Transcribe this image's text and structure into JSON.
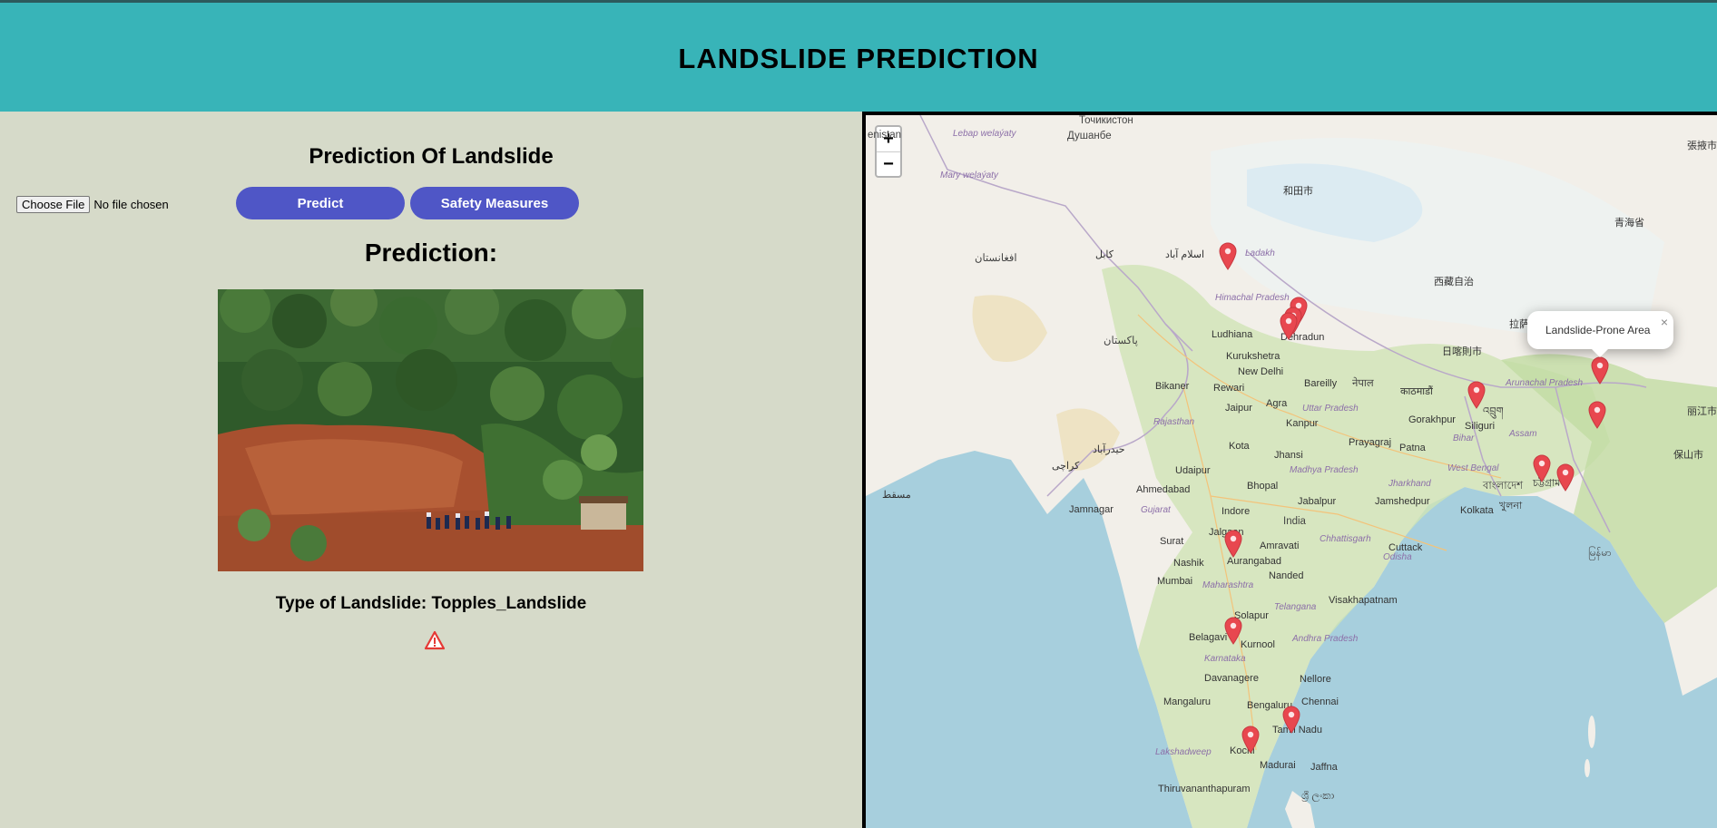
{
  "header": {
    "title": "LANDSLIDE PREDICTION"
  },
  "left": {
    "section_title": "Prediction Of Landslide",
    "file_button": "Choose File",
    "file_status": "No file chosen",
    "predict_button": "Predict",
    "safety_button": "Safety Measures",
    "prediction_label": "Prediction:",
    "type_text": "Type of Landslide: Topples_Landslide"
  },
  "map": {
    "zoom_in": "+",
    "zoom_out": "−",
    "popup_text": "Landslide-Prone Area",
    "popup_close": "×",
    "labels": {
      "dushanbe": "Душанбе",
      "tajik": "Точикистон",
      "turkmenistan": "enistan",
      "lebap": "Lebap welaýaty",
      "mary": "Mary welaýaty",
      "afghanistan": "افغانستان",
      "kabul": "کابل",
      "islamabad": "اسلام آباد",
      "pakistan": "پاکستان",
      "ladakh": "Ladakh",
      "himachal": "Himachal Pradesh",
      "dehradun": "Dehradun",
      "ludhiana": "Ludhiana",
      "kurukshetra": "Kurukshetra",
      "newdelhi": "New Delhi",
      "rewari": "Rewari",
      "bikaner": "Bikaner",
      "jaipur": "Jaipur",
      "agra": "Agra",
      "kanpur": "Kanpur",
      "bareilly": "Bareilly",
      "uttar": "Uttar Pradesh",
      "nepal": "नेपाल",
      "gorakhpur": "Gorakhpur",
      "patna": "Patna",
      "bihar": "Bihar",
      "prayagraj": "Prayagraj",
      "siliguri": "Siliguri",
      "kota": "Kota",
      "jhansi": "Jhansi",
      "udaipur": "Udaipur",
      "bhopal": "Bhopal",
      "madhya": "Madhya Pradesh",
      "ahmedabad": "Ahmedabad",
      "jamnagar": "Jamnagar",
      "gujarat": "Gujarat",
      "indore": "Indore",
      "jabalpur": "Jabalpur",
      "jamshedpur": "Jamshedpur",
      "jharkhand": "Jharkhand",
      "kolkata": "Kolkata",
      "westbengal": "West Bengal",
      "india": "India",
      "jalgaon": "Jalgaon",
      "amravati": "Amravati",
      "surat": "Surat",
      "chhattisgarh": "Chhattisgarh",
      "cuttack": "Cuttack",
      "odisha": "Odisha",
      "nashik": "Nashik",
      "aurangabad": "Aurangabad",
      "nanded": "Nanded",
      "mumbai": "Mumbai",
      "maharashtra": "Maharashtra",
      "telangana": "Telangana",
      "visakhapatnam": "Visakhapatnam",
      "solapur": "Solapur",
      "belagavi": "Belagavi",
      "kurnool": "Kurnool",
      "karnataka": "Karnataka",
      "andhra": "Andhra Pradesh",
      "davanagere": "Davanagere",
      "nellore": "Nellore",
      "mangaluru": "Mangaluru",
      "bengaluru": "Bengaluru",
      "chennai": "Chennai",
      "salem": "Salem",
      "tamilnadu": "Tamil Nadu",
      "kochi": "Kochi",
      "madurai": "Madurai",
      "lakshadweep": "Lakshadweep",
      "thiruvananthapuram": "Thiruvananthapuram",
      "jaffna": "Jaffna",
      "srilanka": "ශ්‍රී ලංකා",
      "karachi": "کراچی",
      "hyderabad_pk": "حیدرآباد",
      "muscat": "مسقط",
      "rajasthan": "Rajasthan",
      "assam": "Assam",
      "arunachal": "Arunachal Pradesh",
      "bhutan": "འབྲུག",
      "bangladesh": "বাংলাদেশ",
      "khulna": "খুলনা",
      "myanmar": "မြန်မာ",
      "tibet": "西藏自治",
      "hotan": "和田市",
      "nepal2": "日喀則市",
      "kathmandu": "काठमाडौं",
      "kangpu": "張掖市",
      "qinghai": "青海省",
      "lijiang": "丽江市",
      "baoshan": "保山市",
      "lhasa": "拉萨",
      "chittagong": "চট্টগ্রাম"
    }
  },
  "colors": {
    "header_bg": "#38b4b8",
    "page_bg": "#d6dac9",
    "button": "#4f56c6",
    "marker": "#e8474f",
    "water": "#a7cfdd",
    "land": "#f2efe9"
  }
}
